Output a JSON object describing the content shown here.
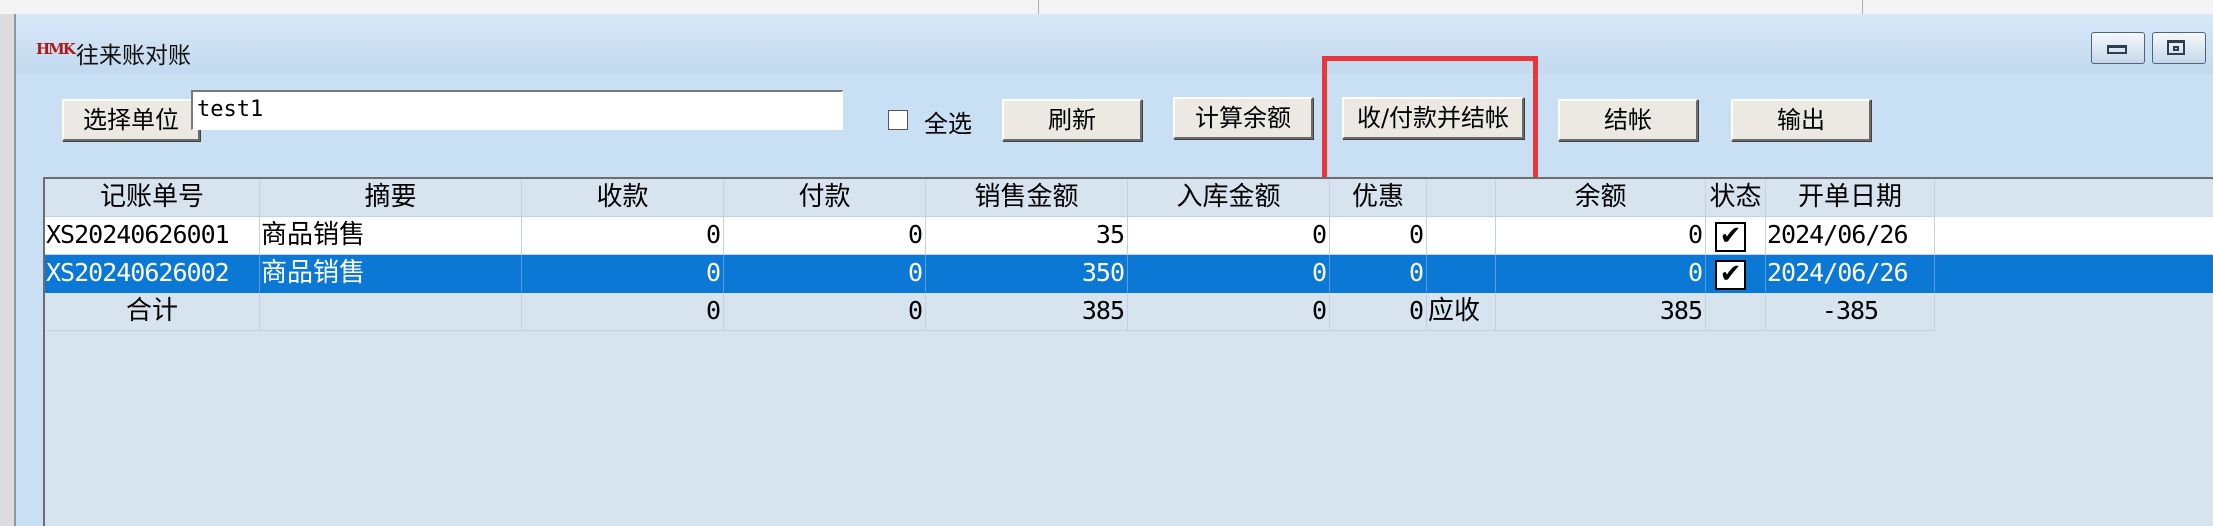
{
  "window": {
    "logo_text": "HMK",
    "title": "往来账对账"
  },
  "toolbar": {
    "select_unit_label": "选择单位",
    "unit_value": "test1",
    "select_all_label": "全选",
    "refresh_label": "刷新",
    "calc_balance_label": "计算余额",
    "collect_pay_settle_label": "收/付款并结帐",
    "settle_label": "结帐",
    "export_label": "输出"
  },
  "table": {
    "columns": [
      "记账单号",
      "摘要",
      "收款",
      "付款",
      "销售金额",
      "入库金额",
      "优惠",
      "",
      "余额",
      "状态",
      "开单日期"
    ],
    "rows": [
      {
        "no": "XS20240626001",
        "summary": "商品销售",
        "receipt": "0",
        "payment": "0",
        "sales": "35",
        "stock_in": "0",
        "discount": "0",
        "extra": "",
        "balance": "0",
        "status_checked": true,
        "status_mark": "✔",
        "date": "2024/06/26",
        "selected": false
      },
      {
        "no": "XS20240626002",
        "summary": "商品销售",
        "receipt": "0",
        "payment": "0",
        "sales": "350",
        "stock_in": "0",
        "discount": "0",
        "extra": "",
        "balance": "0",
        "status_checked": true,
        "status_mark": "✔",
        "date": "2024/06/26",
        "selected": true
      }
    ],
    "total": {
      "label": "合计",
      "summary": "",
      "receipt": "0",
      "payment": "0",
      "sales": "385",
      "stock_in": "0",
      "discount": "0",
      "extra": "应收",
      "balance": "385",
      "status": "",
      "date": "-385"
    }
  },
  "colors": {
    "selection": "#0a78d4",
    "highlight_box": "#e8363a",
    "grid_bg": "#d7e4f0"
  }
}
